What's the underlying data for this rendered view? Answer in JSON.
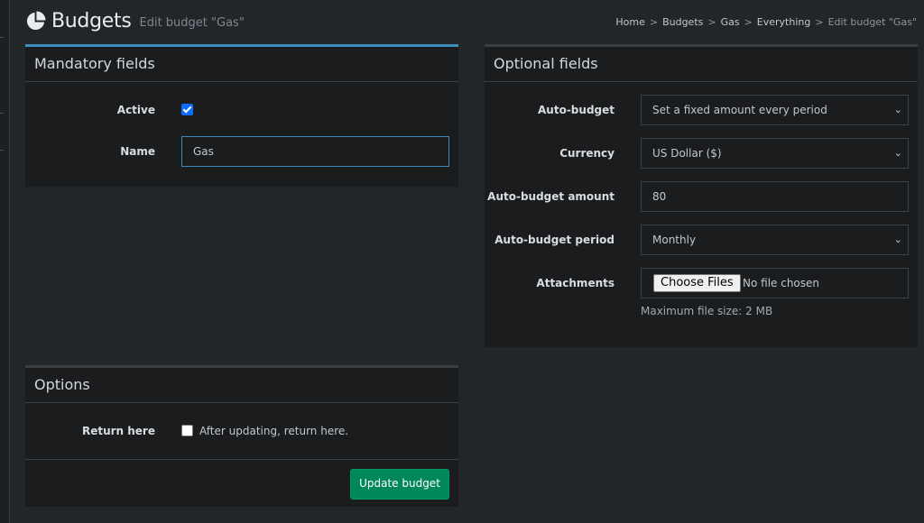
{
  "header": {
    "title": "Budgets",
    "subtitle": "Edit budget \"Gas\""
  },
  "breadcrumb": {
    "items": [
      "Home",
      "Budgets",
      "Gas",
      "Everything"
    ],
    "separator": ">",
    "current": "Edit budget \"Gas\""
  },
  "mandatory": {
    "title": "Mandatory fields",
    "active_label": "Active",
    "active_checked": true,
    "name_label": "Name",
    "name_value": "Gas"
  },
  "optional": {
    "title": "Optional fields",
    "auto_budget_label": "Auto-budget",
    "auto_budget_value": "Set a fixed amount every period",
    "currency_label": "Currency",
    "currency_value": "US Dollar ($)",
    "amount_label": "Auto-budget amount",
    "amount_value": "80",
    "period_label": "Auto-budget period",
    "period_value": "Monthly",
    "attachments_label": "Attachments",
    "choose_files": "Choose Files",
    "no_file": "No file chosen",
    "max_size": "Maximum file size: 2 MB"
  },
  "options": {
    "title": "Options",
    "return_label": "Return here",
    "return_checked": false,
    "return_text": "After updating, return here.",
    "submit_label": "Update budget"
  },
  "colors": {
    "accent": "#3c8dbc",
    "success": "#00875a",
    "checkbox": "#0d6efd",
    "background": "#222629",
    "card": "#1a1c1e"
  },
  "icons": {
    "title_icon": "pie-chart-icon",
    "select_icon": "chevron-down-icon"
  }
}
